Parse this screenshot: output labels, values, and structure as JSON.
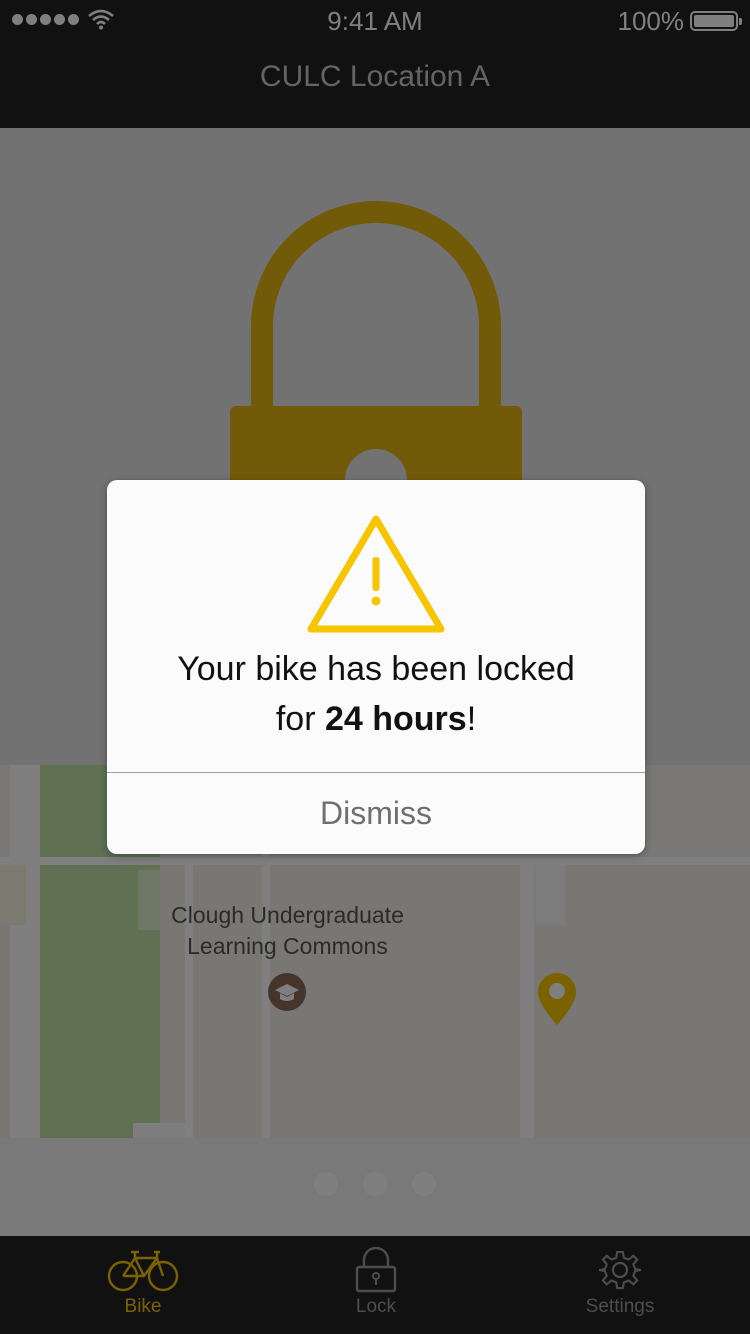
{
  "status_bar": {
    "time": "9:41 AM",
    "battery_percent": "100%",
    "signal_bars": 5
  },
  "nav": {
    "title": "CULC Location A"
  },
  "hero": {
    "icon": "padlock-icon",
    "icon_color": "#e2b510"
  },
  "map": {
    "place_label": "Clough Undergraduate Learning Commons",
    "poi_icon": "graduation-cap-icon",
    "pin_icon": "map-pin-icon",
    "pin_color": "#f7c400"
  },
  "pager": {
    "page_count": 3,
    "current_page": 1
  },
  "tabs": [
    {
      "label": "Bike",
      "icon": "bicycle-icon",
      "selected": true
    },
    {
      "label": "Lock",
      "icon": "lock-icon",
      "selected": false
    },
    {
      "label": "Settings",
      "icon": "gear-icon",
      "selected": false
    }
  ],
  "alert": {
    "icon": "warning-triangle-icon",
    "message_line1": "Your bike has been locked",
    "message_prefix": "for ",
    "message_bold": "24 hours",
    "message_suffix": "!",
    "dismiss_label": "Dismiss"
  },
  "colors": {
    "accent": "#f7c400",
    "bar_background": "#222222",
    "overlay": "rgba(0,0,0,0.5)"
  }
}
